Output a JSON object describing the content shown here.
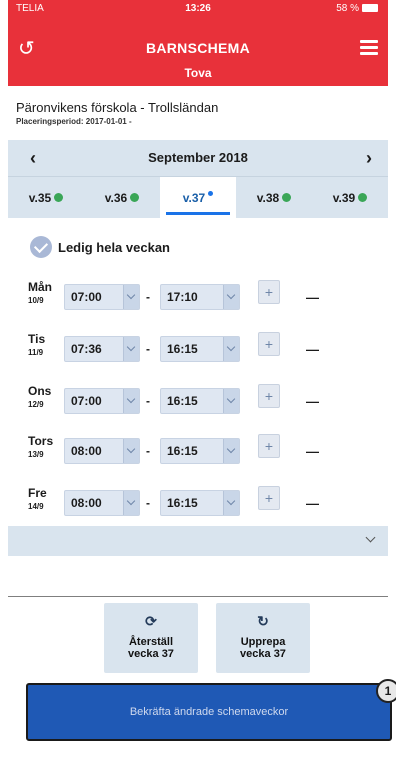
{
  "status": {
    "carrier": "TELIA",
    "time": "13:26",
    "battery": "58 %"
  },
  "header": {
    "title": "BARNSCHEMA",
    "child": "Tova"
  },
  "info": {
    "name": "Päronvikens förskola - Trollsländan",
    "period": "Placeringsperiod: 2017-01-01 -"
  },
  "month": {
    "label": "September 2018"
  },
  "weeks": [
    {
      "label": "v.35",
      "status": "done"
    },
    {
      "label": "v.36",
      "status": "done"
    },
    {
      "label": "v.37",
      "status": "active"
    },
    {
      "label": "v.38",
      "status": "done"
    },
    {
      "label": "v.39",
      "status": "done"
    }
  ],
  "free_week": {
    "label": "Ledig hela veckan"
  },
  "days": [
    {
      "name": "Mån",
      "date": "10/9",
      "start": "07:00",
      "end": "17:10",
      "add": "+",
      "dash": "—"
    },
    {
      "name": "Tis",
      "date": "11/9",
      "start": "07:36",
      "end": "16:15",
      "add": "+",
      "dash": "—"
    },
    {
      "name": "Ons",
      "date": "12/9",
      "start": "07:00",
      "end": "16:15",
      "add": "+",
      "dash": "—"
    },
    {
      "name": "Tors",
      "date": "13/9",
      "start": "08:00",
      "end": "16:15",
      "add": "+",
      "dash": "—"
    },
    {
      "name": "Fre",
      "date": "14/9",
      "start": "08:00",
      "end": "16:15",
      "add": "+",
      "dash": "—"
    }
  ],
  "actions": {
    "reset": {
      "line1": "Återställ",
      "line2": "vecka 37"
    },
    "repeat": {
      "line1": "Upprepa",
      "line2": "vecka 37"
    }
  },
  "confirm": {
    "label": "Bekräfta ändrade schemaveckor",
    "badge": "1"
  },
  "colors": {
    "brand": "#e8313a",
    "accent": "#1f59b5",
    "done": "#3aa657"
  }
}
